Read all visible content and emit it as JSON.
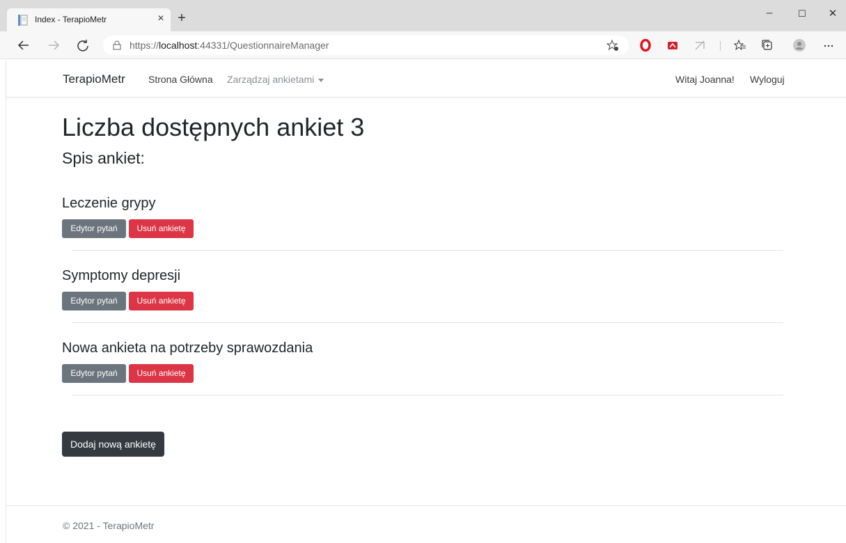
{
  "browser": {
    "tab_title": "Index - TerapioMetr",
    "tab_close": "×",
    "new_tab": "+",
    "window_controls": {
      "minimize": "–",
      "maximize": "☐",
      "close": "✕"
    },
    "url_prefix": "https://",
    "url_host": "localhost",
    "url_rest": ":44331/QuestionnaireManager",
    "icons": [
      "back-icon",
      "forward-icon",
      "refresh-icon",
      "lock-icon",
      "favorite-add-icon",
      "opera-extension-icon",
      "red-extension-icon",
      "cast-icon",
      "favorites-icon",
      "collections-icon",
      "profile-icon",
      "more-icon"
    ]
  },
  "navbar": {
    "brand": "TerapioMetr",
    "home": "Strona Główna",
    "manage": "Zarządzaj ankietami",
    "greeting": "Witaj Joanna!",
    "logout": "Wyloguj"
  },
  "main": {
    "title": "Liczba dostępnych ankiet 3",
    "subtitle": "Spis ankiet:",
    "surveys": [
      {
        "name": "Leczenie grypy",
        "edit_label": "Edytor pytań",
        "delete_label": "Usuń ankietę"
      },
      {
        "name": "Symptomy depresji",
        "edit_label": "Edytor pytań",
        "delete_label": "Usuń ankietę"
      },
      {
        "name": "Nowa ankieta na potrzeby sprawozdania",
        "edit_label": "Edytor pytań",
        "delete_label": "Usuń ankietę"
      }
    ],
    "add_label": "Dodaj nową ankietę"
  },
  "footer": {
    "text": "© 2021 - TerapioMetr"
  },
  "colors": {
    "secondary": "#6c757d",
    "danger": "#dc3545",
    "dark": "#343a40"
  }
}
